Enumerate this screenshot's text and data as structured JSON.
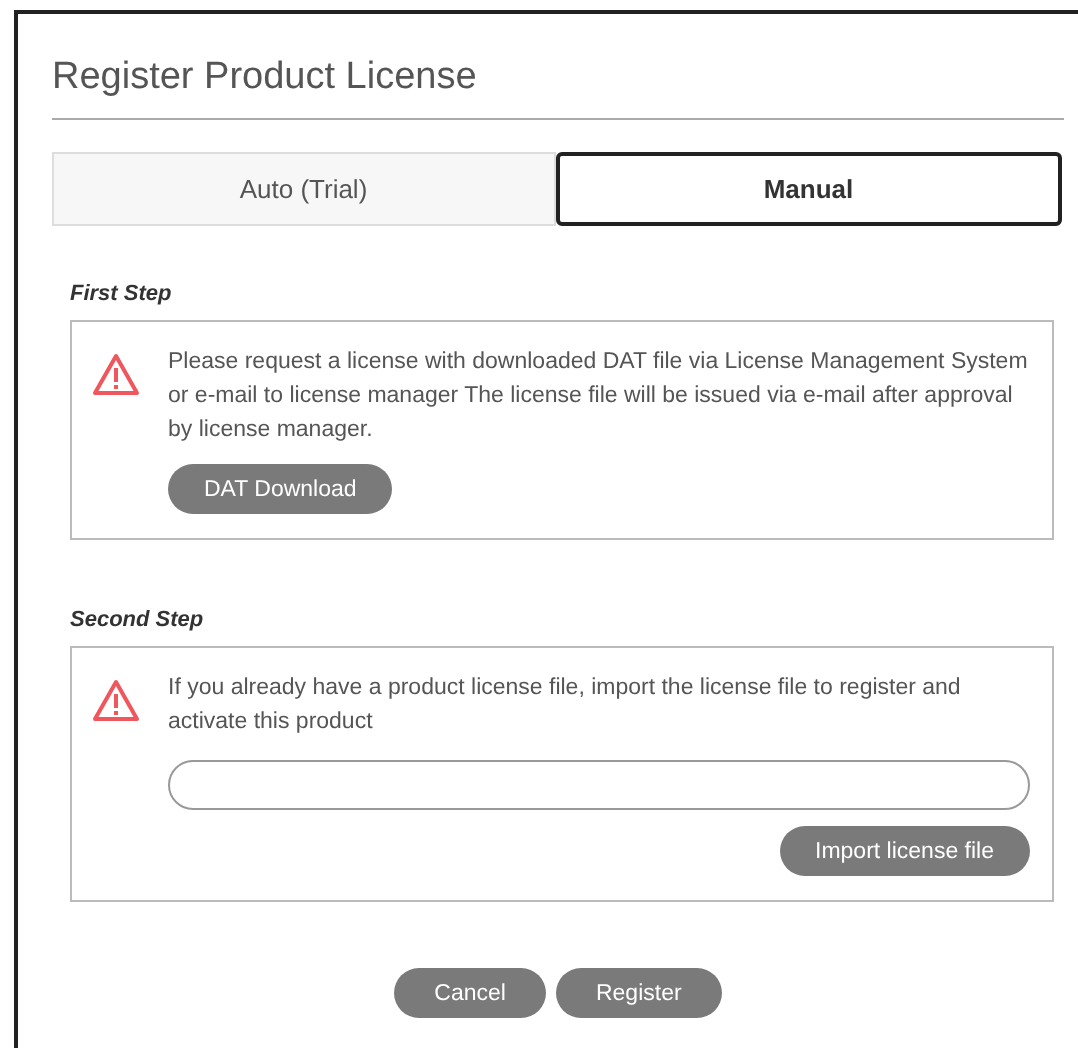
{
  "dialog": {
    "title": "Register Product License"
  },
  "tabs": [
    {
      "label": "Auto (Trial)",
      "selected": false
    },
    {
      "label": "Manual",
      "selected": true
    }
  ],
  "steps": [
    {
      "kind": "download",
      "heading": "First Step",
      "message": "Please request a license with downloaded DAT file via License Management System or e-mail to license manager The license file will be issued via e-mail after approval by license manager.",
      "button": "DAT Download"
    },
    {
      "kind": "import",
      "heading": "Second Step",
      "message": "If you already have a product license file, import the license file to register and activate this product",
      "button": "Import license file"
    }
  ],
  "buttons": [
    "Cancel",
    "Register"
  ]
}
